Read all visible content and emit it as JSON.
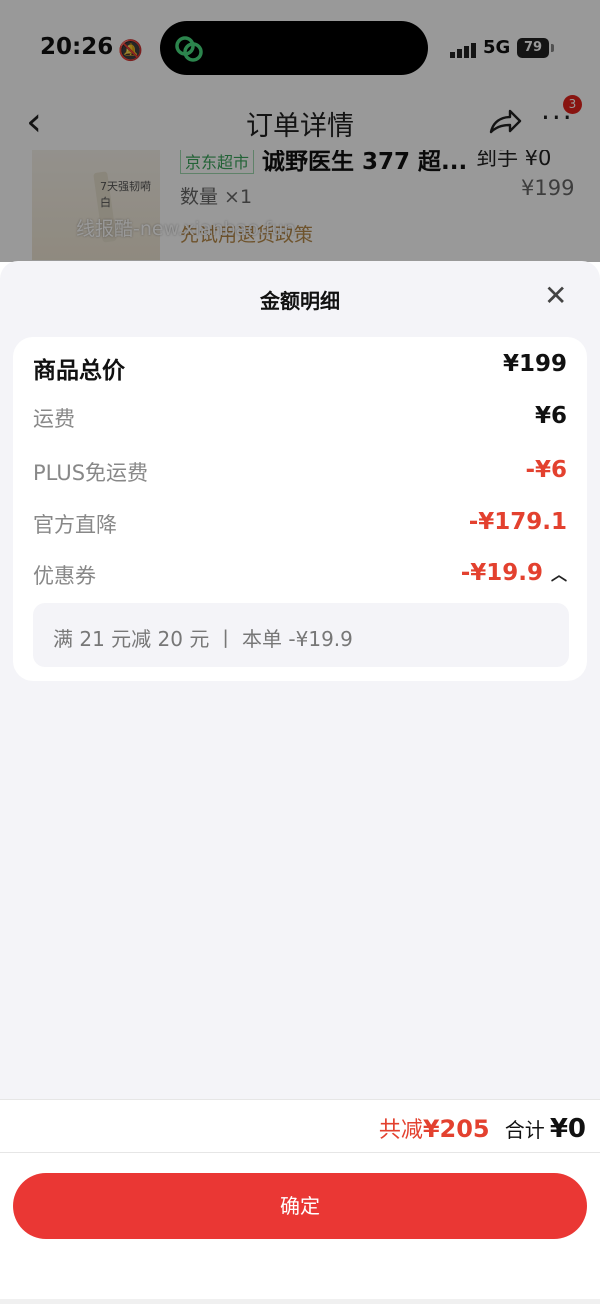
{
  "status_bar": {
    "time": "20:26",
    "network": "5G",
    "battery": "79"
  },
  "nav": {
    "title": "订单详情",
    "badge_count": "3"
  },
  "product": {
    "tag": "京东超市",
    "title": "诚野医生 377 超...",
    "price_hint": "到手 ¥0",
    "thumb_text": "7天强韧嗬白",
    "quantity": "数量 ×1",
    "price": "¥199",
    "promo": "先试用退货政策"
  },
  "watermark": "线报酷-new.xianbao.fun",
  "sheet": {
    "title": "金额明细",
    "rows": [
      {
        "label": "商品总价",
        "value": "¥199"
      },
      {
        "label": "运费",
        "value": "¥6"
      },
      {
        "label": "PLUS免运费",
        "value": "-¥6"
      },
      {
        "label": "官方直降",
        "value": "-¥179.1"
      },
      {
        "label": "优惠券",
        "value": "-¥19.9"
      }
    ],
    "coupon_detail": "满 21 元减 20 元  丨 本单 -¥19.9"
  },
  "footer": {
    "saved_label": "共减",
    "saved_value": "¥205",
    "total_label": "合计",
    "total_value": "¥0",
    "confirm_label": "确定"
  },
  "colors": {
    "accent": "#ea3734",
    "discount": "#e3412f",
    "sheet_bg": "#f4f4f8"
  }
}
